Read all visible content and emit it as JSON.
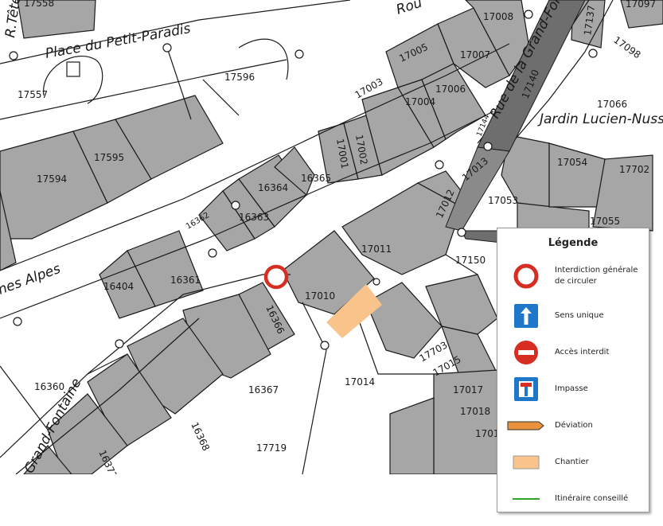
{
  "colors": {
    "building": "#a6a6a6",
    "building_dark": "#8c8c8c",
    "parcel_line": "#1a1a1a",
    "street_fill": "#ffffff",
    "interdiction_red": "#d62e22",
    "sens_unique_blue": "#1f77c9",
    "deviation_orange": "#e9913d",
    "chantier_orange": "#f9c48c",
    "itineraire_green": "#2da52d"
  },
  "streets": {
    "place_petit_paradis": "Place du Petit-Paradis",
    "rue_grand_fontaine": "Rue de la Grand-Fontaine",
    "jardin": "Jardin Lucien-Nussbaumer",
    "alpes": "nes Alpes",
    "grand_fontaine_sw": "Grand-Fontaine",
    "r_tete": "R.Tête",
    "route": "Rou"
  },
  "parcels": {
    "p17558": "17558",
    "p17557": "17557",
    "p17596": "17596",
    "p17595": "17595",
    "p17594": "17594",
    "p17003": "17003",
    "p17005": "17005",
    "p17004": "17004",
    "p17006": "17006",
    "p17007": "17007",
    "p17008": "17008",
    "p17137": "17137",
    "p17097": "17097",
    "p17098": "17098",
    "p17066": "17066",
    "p17140": "17140",
    "p17144": "17144",
    "p17001": "17001",
    "p17002": "17002",
    "p16365": "16365",
    "p16364": "16364",
    "p16363": "16363",
    "p16362": "16362",
    "p17013": "17013",
    "p17012": "17012",
    "p17053": "17053",
    "p17054": "17054",
    "p17702": "17702",
    "p17055": "17055",
    "p17011": "17011",
    "p17150": "17150",
    "p16404": "16404",
    "p16361": "16361",
    "p17010": "17010",
    "p16366": "16366",
    "p17703": "17703",
    "p17015": "17015",
    "p17014": "17014",
    "p17017": "17017",
    "p17018": "17018",
    "p1701x": "1701",
    "p16360": "16360",
    "p16367": "16367",
    "p16368": "16368",
    "p17719": "17719",
    "p16372": "16372"
  },
  "legend": {
    "title": "Légende",
    "items": [
      {
        "label": "Interdiction générale de circuler",
        "icon": "interdiction-generale-icon"
      },
      {
        "label": "Sens unique",
        "icon": "sens-unique-icon"
      },
      {
        "label": "Accès interdit",
        "icon": "acces-interdit-icon"
      },
      {
        "label": "Impasse",
        "icon": "impasse-icon"
      },
      {
        "label": "Déviation",
        "icon": "deviation-icon"
      },
      {
        "label": "Chantier",
        "icon": "chantier-icon"
      },
      {
        "label": "Itinéraire conseillé",
        "icon": "itineraire-conseille-icon"
      }
    ]
  }
}
